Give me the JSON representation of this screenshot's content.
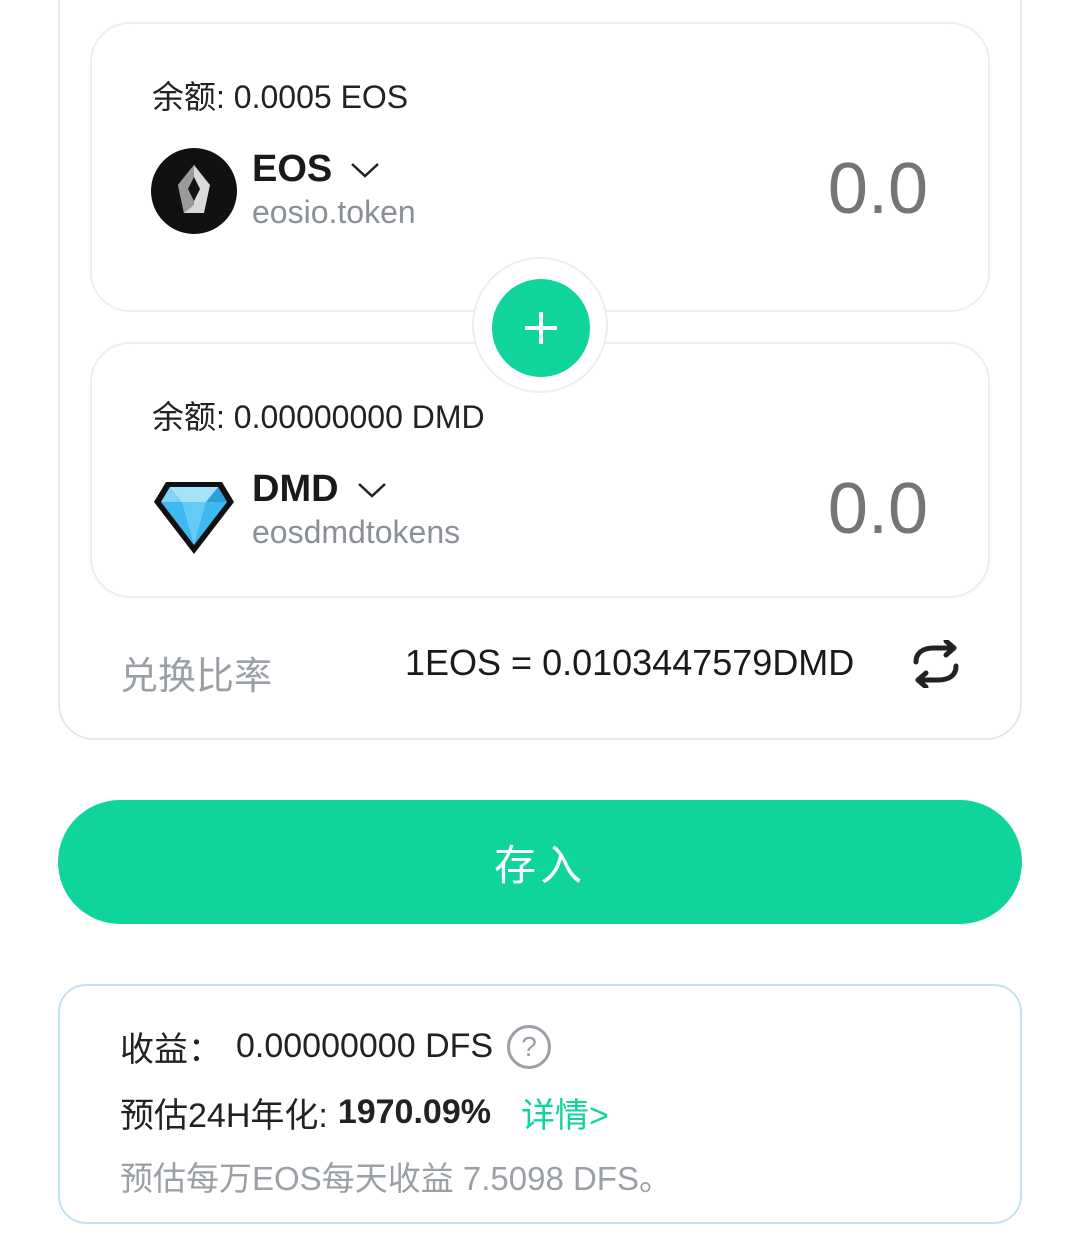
{
  "pool": {
    "token_a": {
      "balance_label": "余额:",
      "balance_value": "0.0005 EOS",
      "symbol": "EOS",
      "contract": "eosio.token",
      "amount_placeholder": "0.0",
      "icon": "eos-logo-icon"
    },
    "token_b": {
      "balance_label": "余额:",
      "balance_value": "0.00000000 DMD",
      "symbol": "DMD",
      "contract": "eosdmdtokens",
      "amount_placeholder": "0.0",
      "icon": "diamond-logo-icon"
    },
    "rate_label": "兑换比率",
    "rate_value": "1EOS = 0.0103447579DMD"
  },
  "deposit_button_label": "存入",
  "info": {
    "earnings_label": "收益：",
    "earnings_value": "0.00000000 DFS",
    "apy_label": "预估24H年化:",
    "apy_value": "1970.09%",
    "details_link": "详情>",
    "daily_estimate": "预估每万EOS每天收益 7.5098 DFS。"
  },
  "colors": {
    "accent": "#0fd49c",
    "muted_text": "#9aa0a6",
    "info_border": "#bfe3f5"
  }
}
